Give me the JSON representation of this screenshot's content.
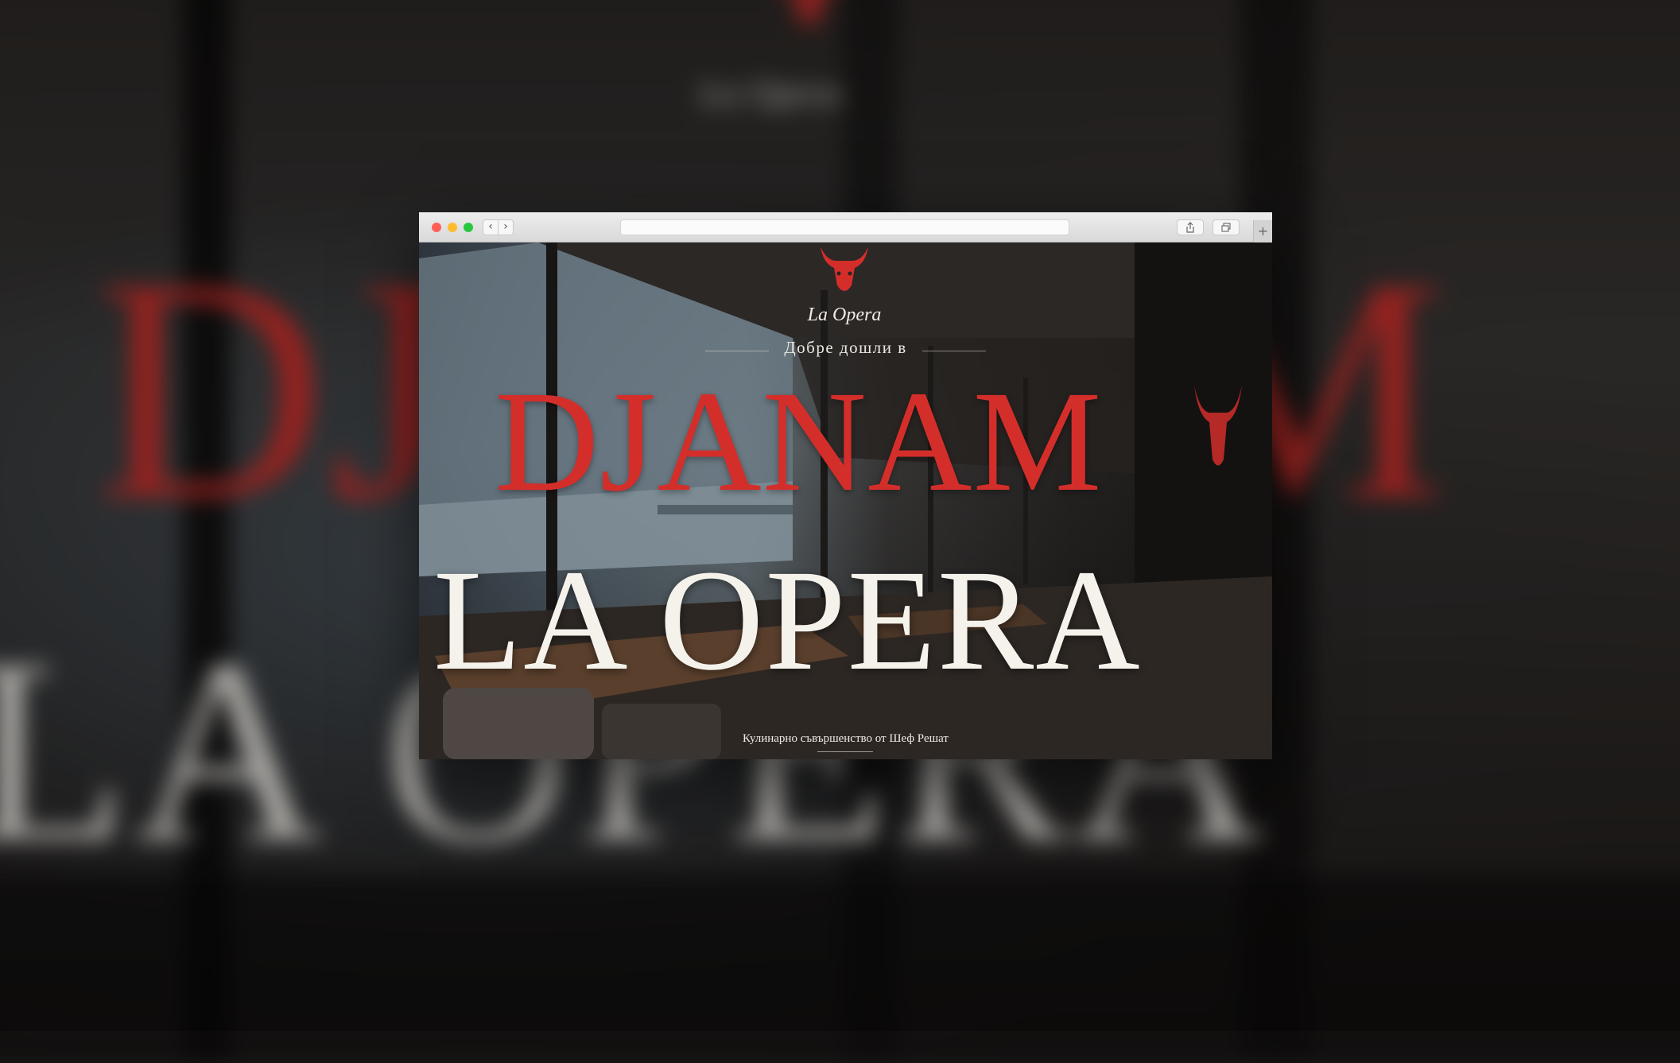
{
  "backdrop": {
    "headline": "DJANAM",
    "title": "LA OPERA",
    "logo_text": "La Opera"
  },
  "browser": {
    "back_icon": "chevron-left-icon",
    "forward_icon": "chevron-right-icon",
    "url": "",
    "share_icon": "share-icon",
    "tabs_icon": "tabs-icon",
    "new_tab_icon": "plus-icon"
  },
  "hero": {
    "logo_text": "La Opera",
    "welcome": "Добре дошли в",
    "headline": "DJANAM",
    "title": "LA OPERA",
    "tagline": "Кулинарно съвършенство от Шеф Решат",
    "accent_color": "#d42e2b"
  }
}
